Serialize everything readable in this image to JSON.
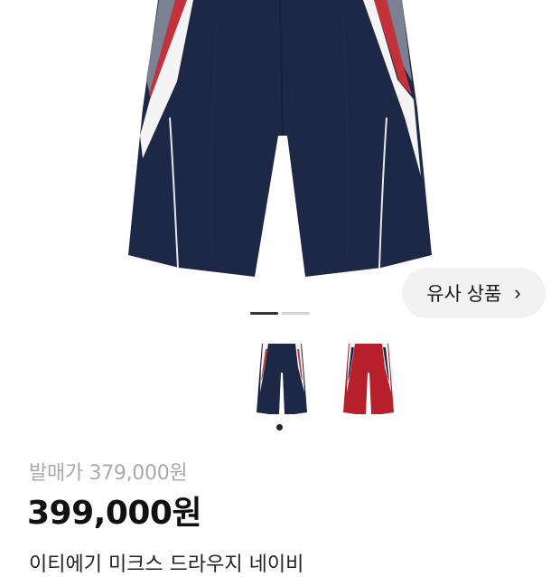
{
  "similar_button": {
    "label": "유사 상품",
    "chevron": "›"
  },
  "gallery": {
    "image_count": 2,
    "active_index": 0
  },
  "thumbnails": [
    {
      "name": "navy",
      "color": "#1c2845"
    },
    {
      "name": "red",
      "color": "#b7202b"
    }
  ],
  "thumbnail_pager": {
    "count": 1,
    "active_index": 0
  },
  "product": {
    "original_price": "발매가 379,000원",
    "price": "399,000원",
    "title_partial": "이티에기 미크스 드라우지 네이비"
  },
  "colors": {
    "navy": "#1c2845",
    "red": "#c3323a",
    "white": "#f4f4f4",
    "grey": "#9aa0ae"
  }
}
